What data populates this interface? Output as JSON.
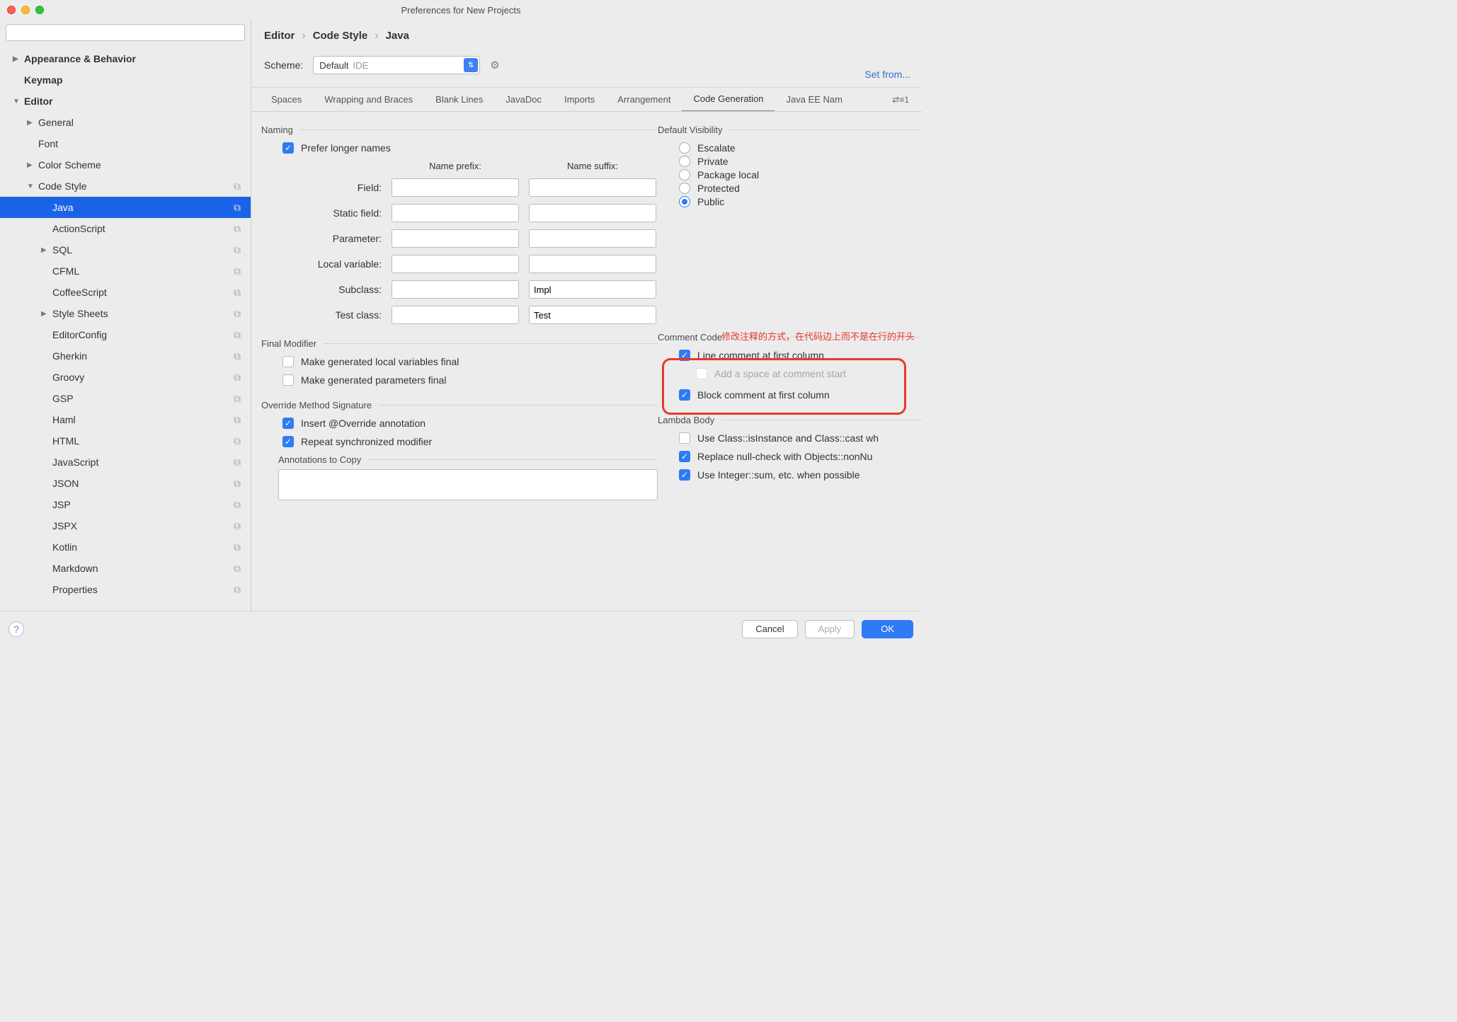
{
  "window": {
    "title": "Preferences for New Projects"
  },
  "search": {
    "placeholder": ""
  },
  "sidebar": {
    "items": [
      {
        "label": "Appearance & Behavior",
        "bold": true,
        "arrow": "▶",
        "lvl": 1
      },
      {
        "label": "Keymap",
        "bold": true,
        "arrow": "",
        "lvl": 1
      },
      {
        "label": "Editor",
        "bold": true,
        "arrow": "▼",
        "lvl": 1
      },
      {
        "label": "General",
        "arrow": "▶",
        "lvl": 2
      },
      {
        "label": "Font",
        "arrow": "",
        "lvl": 2
      },
      {
        "label": "Color Scheme",
        "arrow": "▶",
        "lvl": 2
      },
      {
        "label": "Code Style",
        "arrow": "▼",
        "lvl": 2,
        "copy": true
      },
      {
        "label": "Java",
        "arrow": "",
        "lvl": 3,
        "selected": true,
        "copy": true
      },
      {
        "label": "ActionScript",
        "arrow": "",
        "lvl": 3,
        "copy": true
      },
      {
        "label": "SQL",
        "arrow": "▶",
        "lvl": 3,
        "copy": true
      },
      {
        "label": "CFML",
        "arrow": "",
        "lvl": 3,
        "copy": true
      },
      {
        "label": "CoffeeScript",
        "arrow": "",
        "lvl": 3,
        "copy": true
      },
      {
        "label": "Style Sheets",
        "arrow": "▶",
        "lvl": 3,
        "copy": true
      },
      {
        "label": "EditorConfig",
        "arrow": "",
        "lvl": 3,
        "copy": true
      },
      {
        "label": "Gherkin",
        "arrow": "",
        "lvl": 3,
        "copy": true
      },
      {
        "label": "Groovy",
        "arrow": "",
        "lvl": 3,
        "copy": true
      },
      {
        "label": "GSP",
        "arrow": "",
        "lvl": 3,
        "copy": true
      },
      {
        "label": "Haml",
        "arrow": "",
        "lvl": 3,
        "copy": true
      },
      {
        "label": "HTML",
        "arrow": "",
        "lvl": 3,
        "copy": true
      },
      {
        "label": "JavaScript",
        "arrow": "",
        "lvl": 3,
        "copy": true
      },
      {
        "label": "JSON",
        "arrow": "",
        "lvl": 3,
        "copy": true
      },
      {
        "label": "JSP",
        "arrow": "",
        "lvl": 3,
        "copy": true
      },
      {
        "label": "JSPX",
        "arrow": "",
        "lvl": 3,
        "copy": true
      },
      {
        "label": "Kotlin",
        "arrow": "",
        "lvl": 3,
        "copy": true
      },
      {
        "label": "Markdown",
        "arrow": "",
        "lvl": 3,
        "copy": true
      },
      {
        "label": "Properties",
        "arrow": "",
        "lvl": 3,
        "copy": true
      }
    ]
  },
  "breadcrumb": {
    "p1": "Editor",
    "p2": "Code Style",
    "p3": "Java"
  },
  "scheme": {
    "label": "Scheme:",
    "value": "Default",
    "badge": "IDE",
    "setfrom": "Set from..."
  },
  "tabs": {
    "items": [
      "Spaces",
      "Wrapping and Braces",
      "Blank Lines",
      "JavaDoc",
      "Imports",
      "Arrangement",
      "Code Generation",
      "Java EE Nam"
    ],
    "active": 6,
    "expand": "⇄≡1"
  },
  "naming": {
    "section": "Naming",
    "prefer": "Prefer longer names",
    "prefix_hdr": "Name prefix:",
    "suffix_hdr": "Name suffix:",
    "rows": [
      {
        "label": "Field:",
        "prefix": "",
        "suffix": ""
      },
      {
        "label": "Static field:",
        "prefix": "",
        "suffix": ""
      },
      {
        "label": "Parameter:",
        "prefix": "",
        "suffix": ""
      },
      {
        "label": "Local variable:",
        "prefix": "",
        "suffix": ""
      },
      {
        "label": "Subclass:",
        "prefix": "",
        "suffix": "Impl"
      },
      {
        "label": "Test class:",
        "prefix": "",
        "suffix": "Test"
      }
    ]
  },
  "visibility": {
    "section": "Default Visibility",
    "options": [
      "Escalate",
      "Private",
      "Package local",
      "Protected",
      "Public"
    ],
    "selected": 4
  },
  "final_mod": {
    "section": "Final Modifier",
    "opt1": "Make generated local variables final",
    "opt2": "Make generated parameters final"
  },
  "comment": {
    "section": "Comment Code",
    "annotation": "修改注释的方式，在代码边上而不是在行的开头",
    "line_first": "Line comment at first column",
    "add_space": "Add a space at comment start",
    "block_first": "Block comment at first column"
  },
  "override": {
    "section": "Override Method Signature",
    "insert": "Insert @Override annotation",
    "repeat": "Repeat synchronized modifier",
    "ann_copy": "Annotations to Copy"
  },
  "lambda": {
    "section": "Lambda Body",
    "o1": "Use Class::isInstance and Class::cast wh",
    "o2": "Replace null-check with Objects::nonNu",
    "o3": "Use Integer::sum, etc. when possible"
  },
  "footer": {
    "cancel": "Cancel",
    "apply": "Apply",
    "ok": "OK"
  }
}
